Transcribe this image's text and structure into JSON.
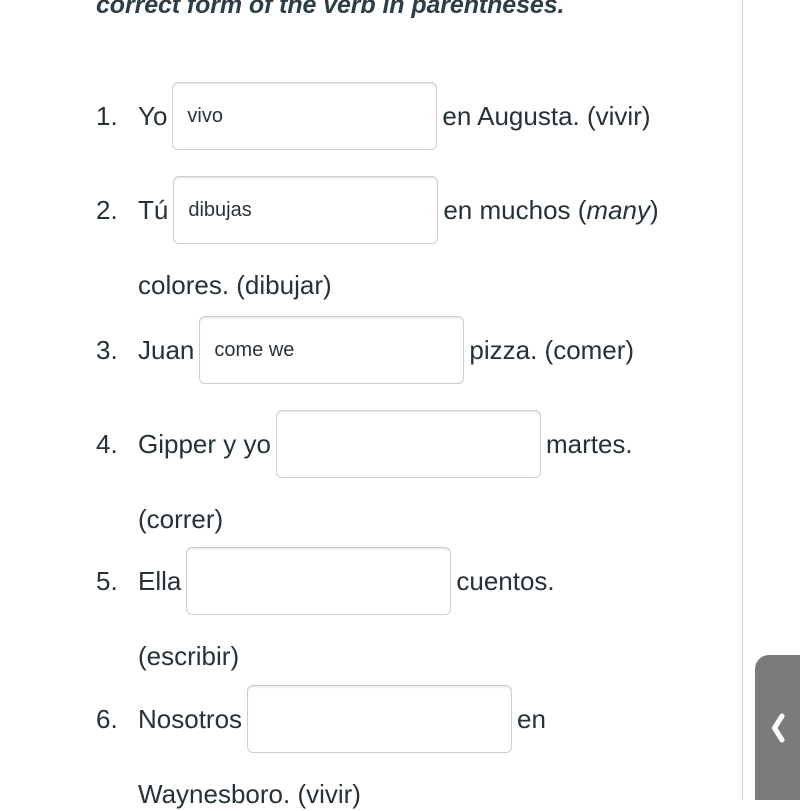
{
  "document": {
    "instructions": "correct form of the verb in parentheses."
  },
  "exercise": {
    "questions": [
      {
        "number": "1.",
        "before": "Yo",
        "input_value": "vivo",
        "input_placeholder": "",
        "after": "en Augusta. (vivir)",
        "continuation": ""
      },
      {
        "number": "2.",
        "before": "Tú",
        "input_value": "dibujas",
        "input_placeholder": "",
        "after": "en muchos (many)",
        "continuation": "colores. (dibujar)"
      },
      {
        "number": "3.",
        "before": "Juan",
        "input_value": "come we",
        "input_placeholder": "",
        "after": "pizza. (comer)",
        "continuation": ""
      },
      {
        "number": "4.",
        "before": "Gipper y yo",
        "input_value": "",
        "input_placeholder": "",
        "after": "martes.",
        "continuation": "(correr)"
      },
      {
        "number": "5.",
        "before": "Ella",
        "input_value": "",
        "input_placeholder": "",
        "after": "cuentos.",
        "continuation": "(escribir)"
      },
      {
        "number": "6.",
        "before": "Nosotros",
        "input_value": "",
        "input_placeholder": "",
        "after": "en",
        "continuation": "Waynesboro. (vivir)"
      }
    ]
  },
  "chrome": {
    "drawer_handle_icon": "chevron-left-icon",
    "scrollbar_thumb_color": "#9e9e9e",
    "drawer_handle_color": "#7b7b7b",
    "divider_color": "#d2d2d2",
    "text_color": "#263238",
    "input_border_color": "#cfcfcf"
  }
}
